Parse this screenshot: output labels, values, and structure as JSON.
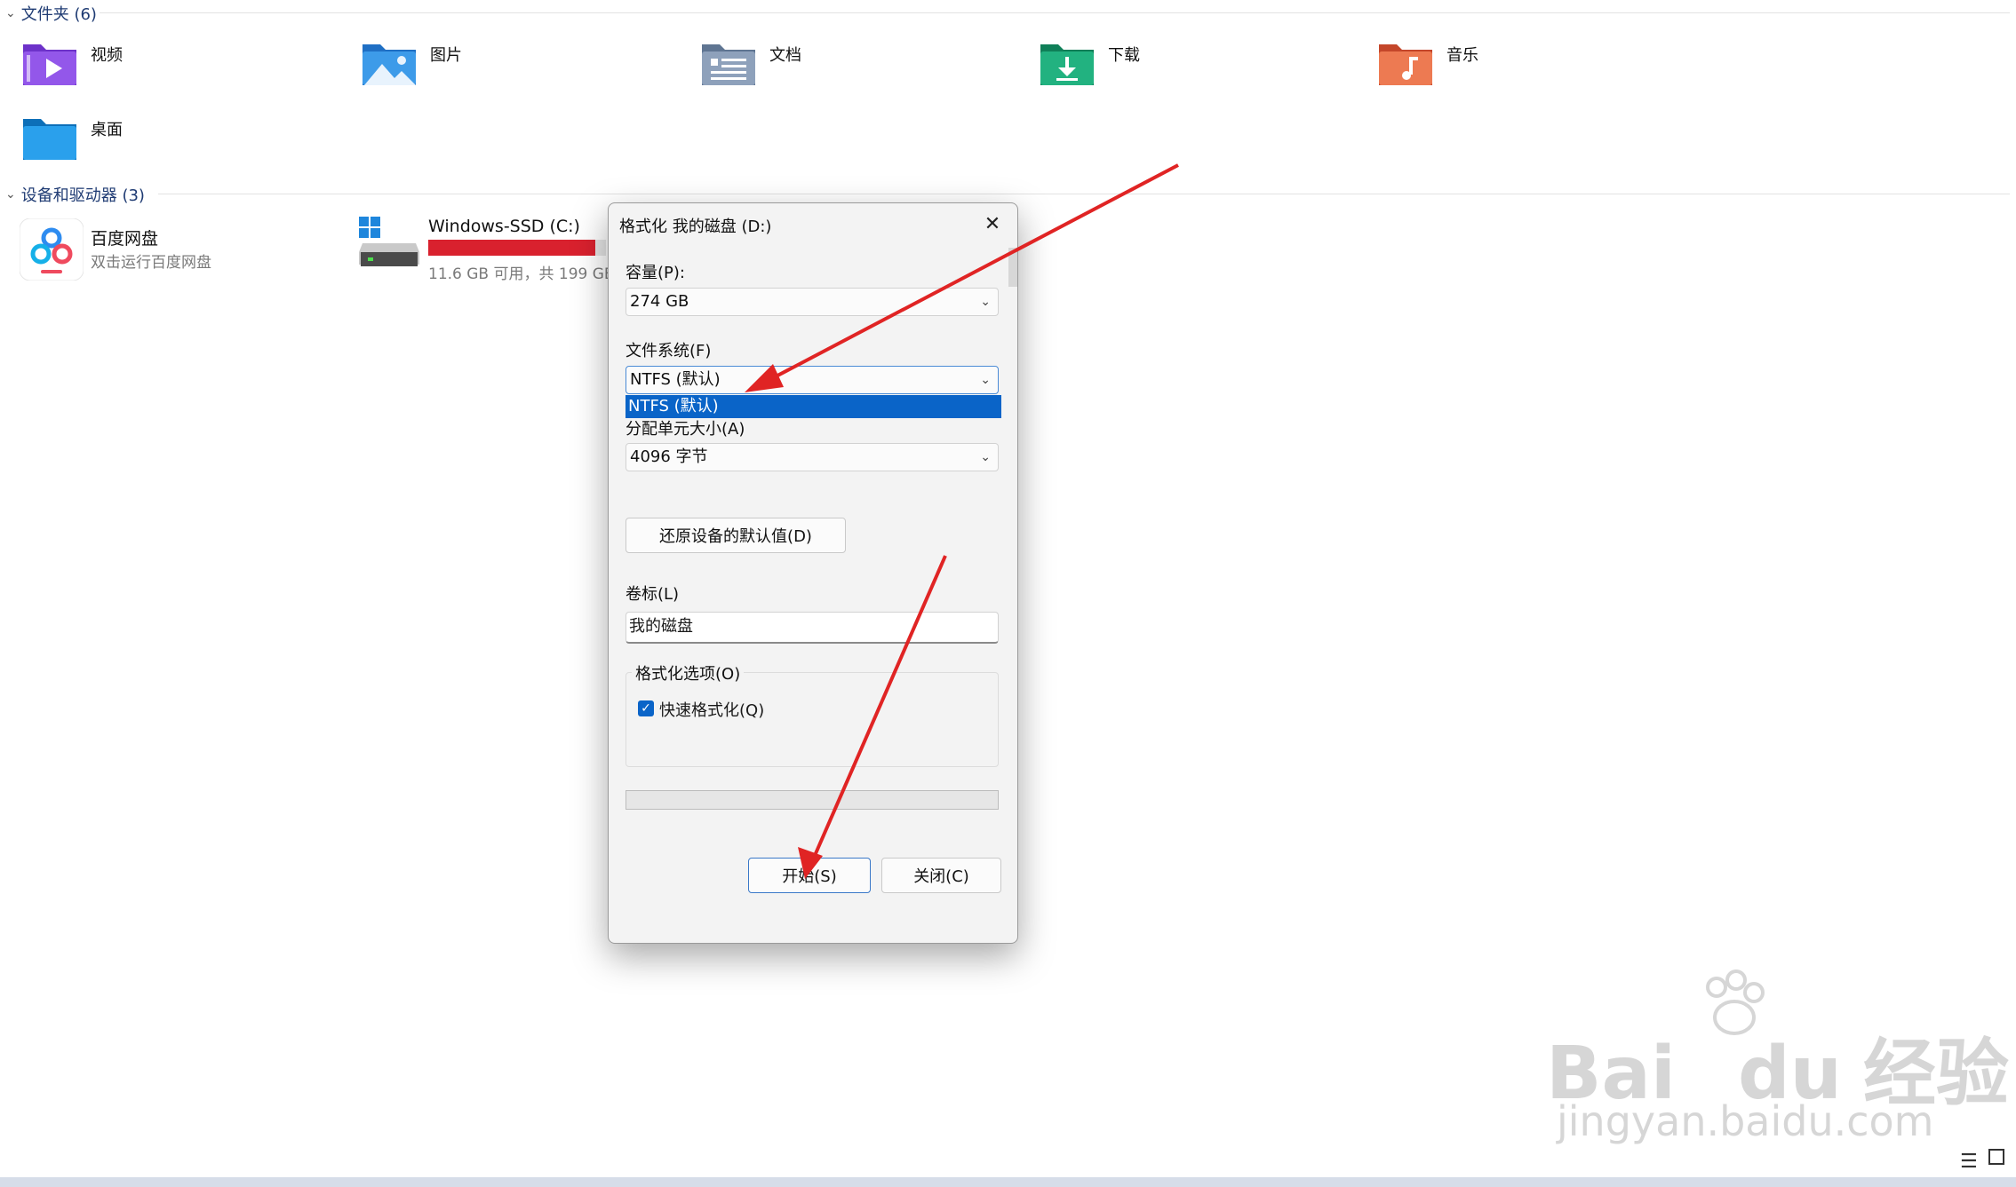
{
  "sections": {
    "folders_header": "文件夹 (6)",
    "drives_header": "设备和驱动器 (3)"
  },
  "folders": [
    {
      "label": "视频",
      "icon": "video-folder-icon",
      "color": "#8b4ce6"
    },
    {
      "label": "图片",
      "icon": "pictures-folder-icon",
      "color": "#2f8de4"
    },
    {
      "label": "文档",
      "icon": "documents-folder-icon",
      "color": "#7f93ad"
    },
    {
      "label": "下载",
      "icon": "downloads-folder-icon",
      "color": "#1fa67a"
    },
    {
      "label": "音乐",
      "icon": "music-folder-icon",
      "color": "#e8643f"
    },
    {
      "label": "桌面",
      "icon": "desktop-folder-icon",
      "color": "#1e8fe0"
    }
  ],
  "drives": {
    "baidu": {
      "title": "百度网盘",
      "subtitle": "双击运行百度网盘"
    },
    "c_drive": {
      "title": "Windows-SSD (C:)",
      "subtitle": "11.6 GB 可用，共 199 GB",
      "used_fraction": 0.94,
      "bar_color": "#d9212e"
    }
  },
  "dialog": {
    "title": "格式化 我的磁盘 (D:)",
    "capacity_label": "容量(P):",
    "capacity_value": "274 GB",
    "filesystem_label": "文件系统(F)",
    "filesystem_value": "NTFS (默认)",
    "filesystem_dropdown_item": "NTFS (默认)",
    "allocation_label": "分配单元大小(A)",
    "allocation_value": "4096 字节",
    "restore_defaults_button": "还原设备的默认值(D)",
    "volume_label": "卷标(L)",
    "volume_value": "我的磁盘",
    "format_options_legend": "格式化选项(O)",
    "quick_format_label": "快速格式化(Q)",
    "quick_format_checked": true,
    "start_button": "开始(S)",
    "close_button": "关闭(C)"
  },
  "watermark": {
    "brand": "Bai",
    "brand_mid": "du",
    "brand_cn": "经验",
    "url": "jingyan.baidu.com"
  },
  "annotations": {
    "arrow_color": "#e02424"
  }
}
